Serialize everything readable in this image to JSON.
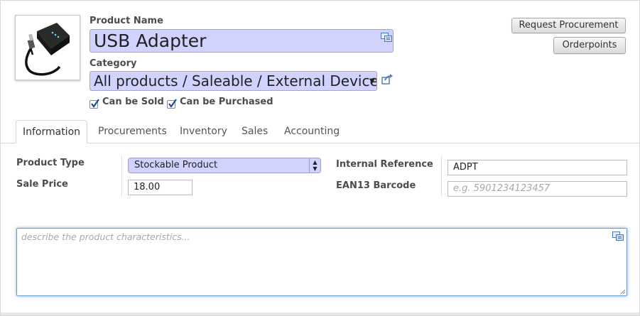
{
  "product": {
    "name_label": "Product Name",
    "name": "USB Adapter",
    "category_label": "Category",
    "category": "All products / Saleable / External Device",
    "can_be_sold_label": "Can be Sold",
    "can_be_sold": true,
    "can_be_purchased_label": "Can be Purchased",
    "can_be_purchased": true,
    "image_icon": "usb-adapter-image"
  },
  "actions": {
    "request_procurement": "Request Procurement",
    "orderpoints": "Orderpoints"
  },
  "tabs": [
    {
      "label": "Information",
      "active": true
    },
    {
      "label": "Procurements",
      "active": false
    },
    {
      "label": "Inventory",
      "active": false
    },
    {
      "label": "Sales",
      "active": false
    },
    {
      "label": "Accounting",
      "active": false
    }
  ],
  "info": {
    "product_type_label": "Product Type",
    "product_type": "Stockable Product",
    "sale_price_label": "Sale Price",
    "sale_price": "18.00",
    "internal_reference_label": "Internal Reference",
    "internal_reference": "ADPT",
    "ean13_label": "EAN13 Barcode",
    "ean13_placeholder": "e.g. 5901234123457",
    "description_placeholder": "describe the product characteristics..."
  },
  "colors": {
    "required_field_bg": "#d2d2ff",
    "focus_border": "#6a9bd6"
  }
}
